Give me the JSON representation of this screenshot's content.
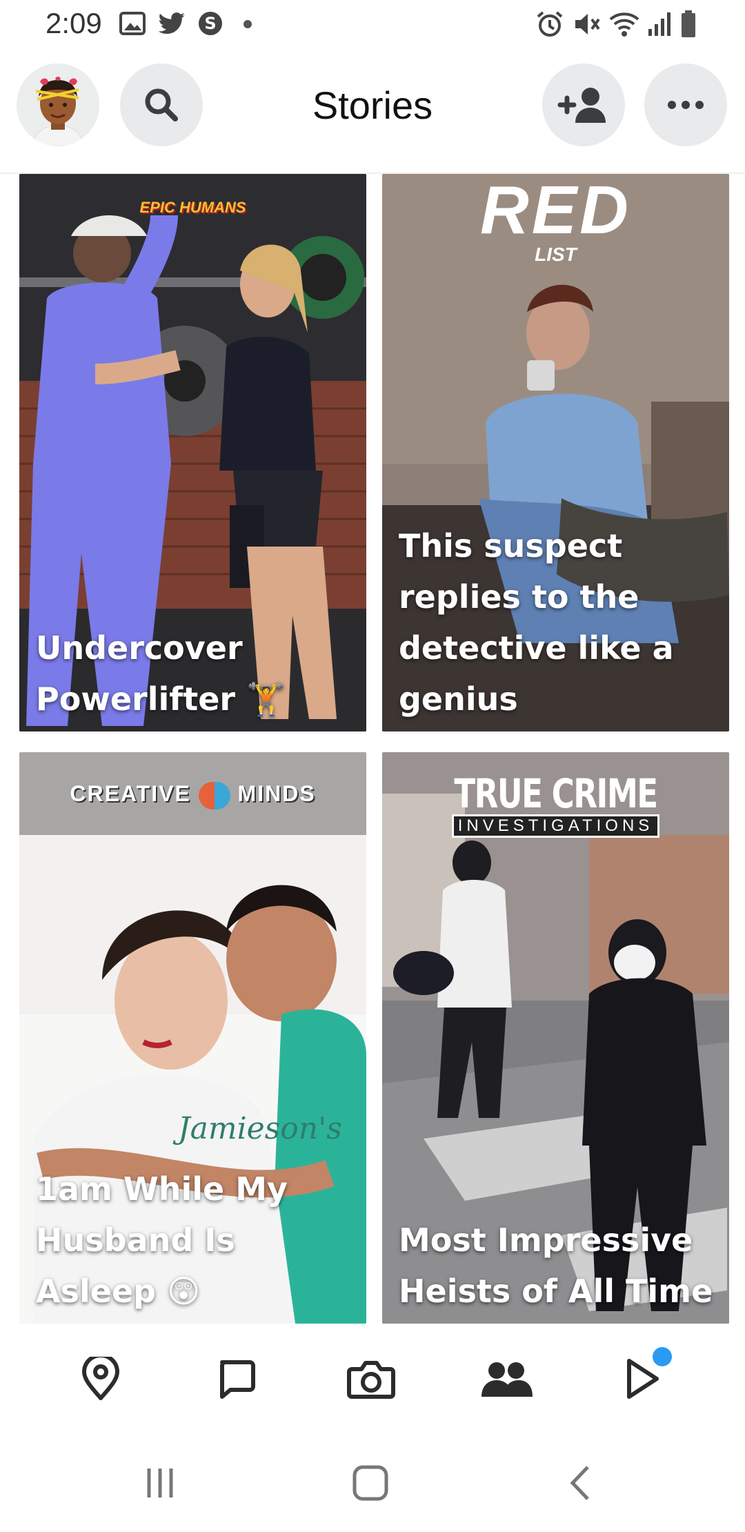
{
  "status_bar": {
    "time": "2:09",
    "left_icons": [
      "image-icon",
      "twitter-icon",
      "stash-icon",
      "dot-icon"
    ],
    "right_icons": [
      "alarm-icon",
      "mute-icon",
      "wifi-icon",
      "signal-icon",
      "battery-icon"
    ]
  },
  "header": {
    "title": "Stories",
    "avatar": "bitmoji-avatar",
    "left_button": "search-icon",
    "right_buttons": [
      "add-friend-icon",
      "more-icon"
    ]
  },
  "stories": [
    {
      "caption": "Undercover Powerlifter 🏋",
      "brand": "EPIC HUMANS",
      "brand_color": "#f2c230"
    },
    {
      "caption": "This suspect replies to the detective like a genius",
      "brand": "RED",
      "brand_sub": "LIST",
      "brand_color": "#ffffff"
    },
    {
      "caption": "1am  While My Husband Is Asleep 😲",
      "brand_left": "CREATIVE",
      "brand_right": "MINDS",
      "brand_color": "#ffffff"
    },
    {
      "caption": "Most Impressive Heists of All Time",
      "brand": "TRUE CRIME",
      "brand_sub": "INVESTIGATIONS",
      "brand_color": "#ffffff"
    }
  ],
  "bottom_nav": {
    "items": [
      "map-icon",
      "chat-icon",
      "camera-icon",
      "friends-icon",
      "spotlight-icon"
    ],
    "active": "friends-icon",
    "notification_color": "#2b9af3"
  },
  "system_nav": [
    "recents-icon",
    "home-icon",
    "back-icon"
  ]
}
